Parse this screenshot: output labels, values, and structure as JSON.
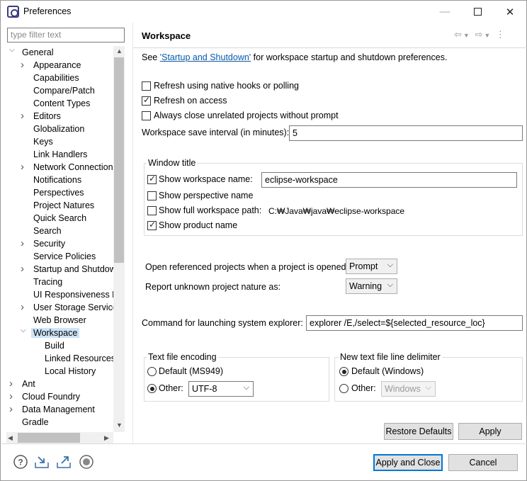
{
  "window": {
    "title": "Preferences"
  },
  "filter": {
    "placeholder": "type filter text"
  },
  "tree": [
    {
      "label": "General",
      "level": 0,
      "arrow": "down"
    },
    {
      "label": "Appearance",
      "level": 1,
      "arrow": "right"
    },
    {
      "label": "Capabilities",
      "level": 1,
      "arrow": ""
    },
    {
      "label": "Compare/Patch",
      "level": 1,
      "arrow": ""
    },
    {
      "label": "Content Types",
      "level": 1,
      "arrow": ""
    },
    {
      "label": "Editors",
      "level": 1,
      "arrow": "right"
    },
    {
      "label": "Globalization",
      "level": 1,
      "arrow": ""
    },
    {
      "label": "Keys",
      "level": 1,
      "arrow": ""
    },
    {
      "label": "Link Handlers",
      "level": 1,
      "arrow": ""
    },
    {
      "label": "Network Connection",
      "level": 1,
      "arrow": "right"
    },
    {
      "label": "Notifications",
      "level": 1,
      "arrow": ""
    },
    {
      "label": "Perspectives",
      "level": 1,
      "arrow": ""
    },
    {
      "label": "Project Natures",
      "level": 1,
      "arrow": ""
    },
    {
      "label": "Quick Search",
      "level": 1,
      "arrow": ""
    },
    {
      "label": "Search",
      "level": 1,
      "arrow": ""
    },
    {
      "label": "Security",
      "level": 1,
      "arrow": "right"
    },
    {
      "label": "Service Policies",
      "level": 1,
      "arrow": ""
    },
    {
      "label": "Startup and Shutdow",
      "level": 1,
      "arrow": "right"
    },
    {
      "label": "Tracing",
      "level": 1,
      "arrow": ""
    },
    {
      "label": "UI Responsiveness M",
      "level": 1,
      "arrow": ""
    },
    {
      "label": "User Storage Service",
      "level": 1,
      "arrow": "right"
    },
    {
      "label": "Web Browser",
      "level": 1,
      "arrow": ""
    },
    {
      "label": "Workspace",
      "level": 1,
      "arrow": "down",
      "selected": true
    },
    {
      "label": "Build",
      "level": 2,
      "arrow": ""
    },
    {
      "label": "Linked Resources",
      "level": 2,
      "arrow": ""
    },
    {
      "label": "Local History",
      "level": 2,
      "arrow": ""
    },
    {
      "label": "Ant",
      "level": 0,
      "arrow": "right"
    },
    {
      "label": "Cloud Foundry",
      "level": 0,
      "arrow": "right"
    },
    {
      "label": "Data Management",
      "level": 0,
      "arrow": "right"
    },
    {
      "label": "Gradle",
      "level": 0,
      "arrow": ""
    }
  ],
  "page": {
    "title": "Workspace",
    "desc_pre": "See ",
    "desc_link": "'Startup and Shutdown'",
    "desc_post": " for workspace startup and shutdown preferences.",
    "refresh_native": {
      "label": "Refresh using native hooks or polling",
      "checked": false
    },
    "refresh_access": {
      "label": "Refresh on access",
      "checked": true
    },
    "always_close": {
      "label": "Always close unrelated projects without prompt",
      "checked": false
    },
    "save_interval_label": "Workspace save interval (in minutes):",
    "save_interval_value": "5",
    "window_title_group": "Window title",
    "show_ws_name": {
      "label": "Show workspace name:",
      "checked": true
    },
    "ws_name_value": "eclipse-workspace",
    "show_perspective": {
      "label": "Show perspective name",
      "checked": false
    },
    "show_full_path": {
      "label": "Show full workspace path:",
      "checked": false
    },
    "full_path_value": "C:₩Java₩java₩eclipse-workspace",
    "show_product": {
      "label": "Show product name",
      "checked": true
    },
    "open_ref_label": "Open referenced projects when a project is opened:",
    "open_ref_value": "Prompt",
    "report_nature_label": "Report unknown project nature as:",
    "report_nature_value": "Warning",
    "cmd_label": "Command for launching system explorer:",
    "cmd_value": "explorer /E,/select=${selected_resource_loc}",
    "encoding_group": "Text file encoding",
    "enc_default_label": "Default (MS949)",
    "enc_other_label": "Other:",
    "enc_other_value": "UTF-8",
    "delim_group": "New text file line delimiter",
    "delim_default_label": "Default (Windows)",
    "delim_other_label": "Other:",
    "delim_other_value": "Windows",
    "restore_defaults": "Restore Defaults",
    "apply": "Apply"
  },
  "footer": {
    "apply_close": "Apply and Close",
    "cancel": "Cancel",
    "icons": [
      "help-icon",
      "import-icon",
      "export-icon",
      "record-icon"
    ]
  }
}
